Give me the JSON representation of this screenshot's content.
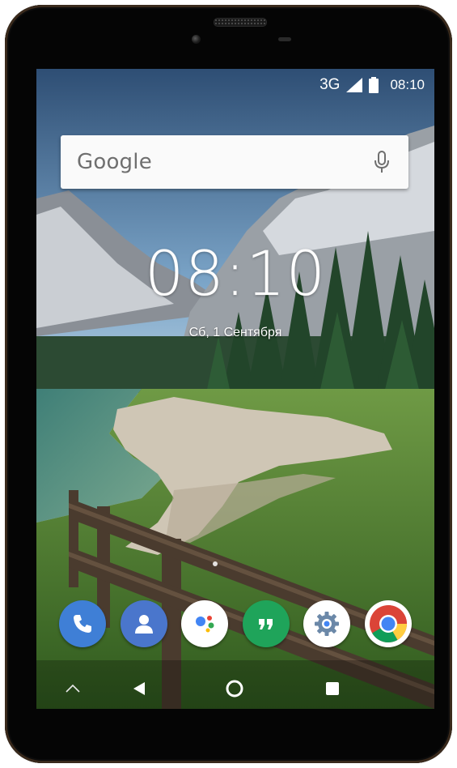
{
  "status_bar": {
    "network": "3G",
    "time": "08:10",
    "icons": [
      "signal-icon",
      "battery-icon"
    ]
  },
  "search": {
    "logo_text": "Google",
    "mic_icon": "mic-icon"
  },
  "lock_clock": {
    "time": "08:10",
    "date": "Сб, 1 Сентября"
  },
  "dock": {
    "apps": [
      {
        "name": "phone",
        "icon": "phone-icon",
        "color": "#3f7fd6"
      },
      {
        "name": "contacts",
        "icon": "person-icon",
        "color": "#4a76cc"
      },
      {
        "name": "assistant",
        "icon": "assistant-icon",
        "color": "#ffffff"
      },
      {
        "name": "hangouts",
        "icon": "quote-icon",
        "color": "#1fa45a"
      },
      {
        "name": "settings",
        "icon": "gear-icon",
        "color": "#ffffff"
      },
      {
        "name": "chrome",
        "icon": "chrome-icon",
        "color": "#ffffff"
      }
    ]
  },
  "nav_bar": {
    "items": [
      "up-chevron-icon",
      "back-icon",
      "home-icon",
      "recents-icon"
    ]
  },
  "colors": {
    "bezel": "#050505",
    "searchbar_bg": "#fafafa",
    "search_text": "#6f6f6f"
  }
}
